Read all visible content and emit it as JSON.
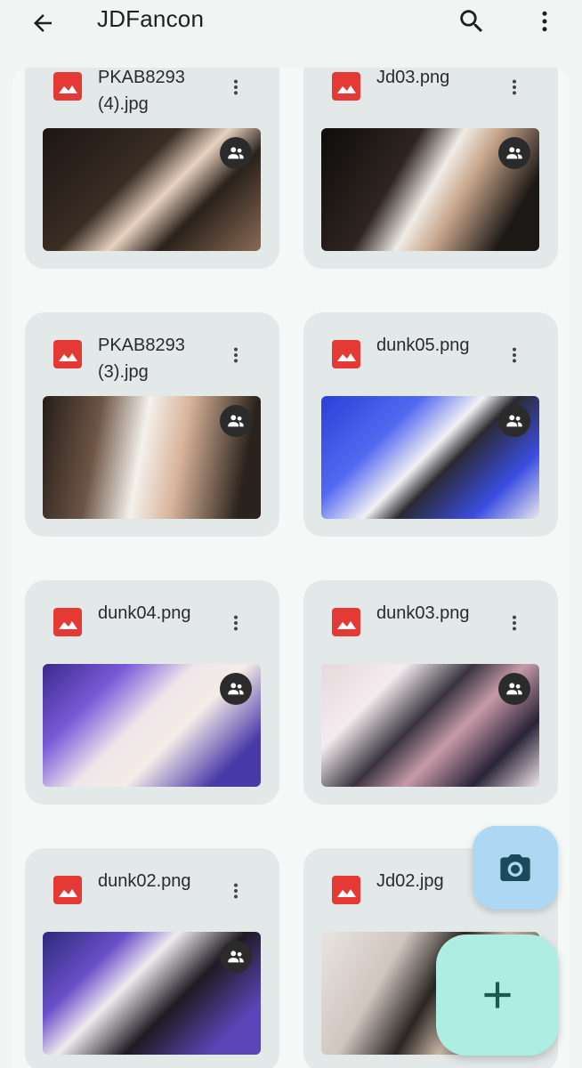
{
  "app_bar": {
    "title": "JDFancon",
    "back_icon": "arrow-back-icon",
    "search_icon": "search-icon",
    "more_icon": "more-vert-icon"
  },
  "files": [
    {
      "name": "PKAB8293(4).jpg",
      "thumb": "t-dark"
    },
    {
      "name": "Jd03.png",
      "thumb": "t-dark2"
    },
    {
      "name": "PKAB8293(3).jpg",
      "thumb": "t-dark3"
    },
    {
      "name": "dunk05.png",
      "thumb": "t-blue1"
    },
    {
      "name": "dunk04.png",
      "thumb": "t-purple1"
    },
    {
      "name": "dunk03.png",
      "thumb": "t-purple2"
    },
    {
      "name": "dunk02.png",
      "thumb": "t-purple3"
    },
    {
      "name": "Jd02.jpg",
      "thumb": "t-mix"
    }
  ],
  "colors": {
    "file_icon": "#e53935",
    "card_bg": "#e3e9e8",
    "fab_camera": "#aed7f3",
    "fab_add": "#aeeee2",
    "fab_icon": "#1b4a5a"
  },
  "fabs": {
    "camera_icon": "camera-icon",
    "add_icon": "add-icon"
  }
}
